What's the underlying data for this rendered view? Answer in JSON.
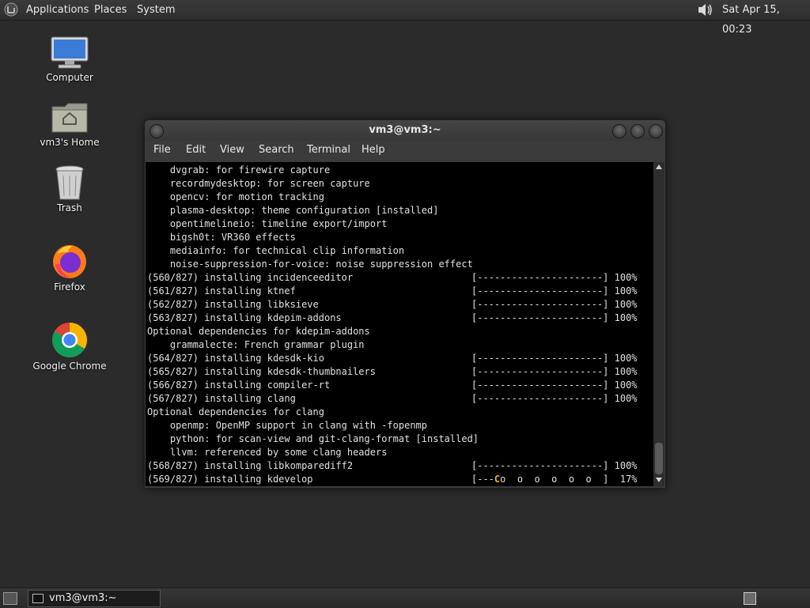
{
  "top_panel": {
    "applications": "Applications",
    "places": "Places",
    "system": "System",
    "clock": "Sat Apr 15, 00:23"
  },
  "desktop_icons": {
    "computer": "Computer",
    "home": "vm3's Home",
    "trash": "Trash",
    "firefox": "Firefox",
    "chrome": "Google Chrome"
  },
  "terminal": {
    "title": "vm3@vm3:~",
    "menu": [
      "File",
      "Edit",
      "View",
      "Search",
      "Terminal",
      "Help"
    ],
    "lines": [
      {
        "text": "    dvgrab: for firewire capture",
        "pct": ""
      },
      {
        "text": "    recordmydesktop: for screen capture",
        "pct": ""
      },
      {
        "text": "    opencv: for motion tracking",
        "pct": ""
      },
      {
        "text": "    plasma-desktop: theme configuration [installed]",
        "pct": ""
      },
      {
        "text": "    opentimelineio: timeline export/import",
        "pct": ""
      },
      {
        "text": "    bigsh0t: VR360 effects",
        "pct": ""
      },
      {
        "text": "    mediainfo: for technical clip information",
        "pct": ""
      },
      {
        "text": "    noise-suppression-for-voice: noise suppression effect",
        "pct": ""
      },
      {
        "text": "(560/827) installing incidenceeditor",
        "pct": "[----------------------] 100%"
      },
      {
        "text": "(561/827) installing ktnef",
        "pct": "[----------------------] 100%"
      },
      {
        "text": "(562/827) installing libksieve",
        "pct": "[----------------------] 100%"
      },
      {
        "text": "(563/827) installing kdepim-addons",
        "pct": "[----------------------] 100%"
      },
      {
        "text": "Optional dependencies for kdepim-addons",
        "pct": ""
      },
      {
        "text": "    grammalecte: French grammar plugin",
        "pct": ""
      },
      {
        "text": "(564/827) installing kdesdk-kio",
        "pct": "[----------------------] 100%"
      },
      {
        "text": "(565/827) installing kdesdk-thumbnailers",
        "pct": "[----------------------] 100%"
      },
      {
        "text": "(566/827) installing compiler-rt",
        "pct": "[----------------------] 100%"
      },
      {
        "text": "(567/827) installing clang",
        "pct": "[----------------------] 100%"
      },
      {
        "text": "Optional dependencies for clang",
        "pct": ""
      },
      {
        "text": "    openmp: OpenMP support in clang with -fopenmp",
        "pct": ""
      },
      {
        "text": "    python: for scan-view and git-clang-format [installed]",
        "pct": ""
      },
      {
        "text": "    llvm: referenced by some clang headers",
        "pct": ""
      },
      {
        "text": "(568/827) installing libkomparediff2",
        "pct": "[----------------------] 100%"
      },
      {
        "text": "(569/827) installing kdevelop",
        "pct": ""
      }
    ],
    "last_bar_prefix": "[---",
    "last_bar_cursor": "C",
    "last_bar_rest": "o  o  o  o  o  o  ]  17%"
  },
  "taskbar": {
    "terminal_task": "vm3@vm3:~"
  },
  "colors": {
    "desktop_bg": "#2b2b2b",
    "terminal_bg": "#000000",
    "cursor": "#e6c200"
  }
}
